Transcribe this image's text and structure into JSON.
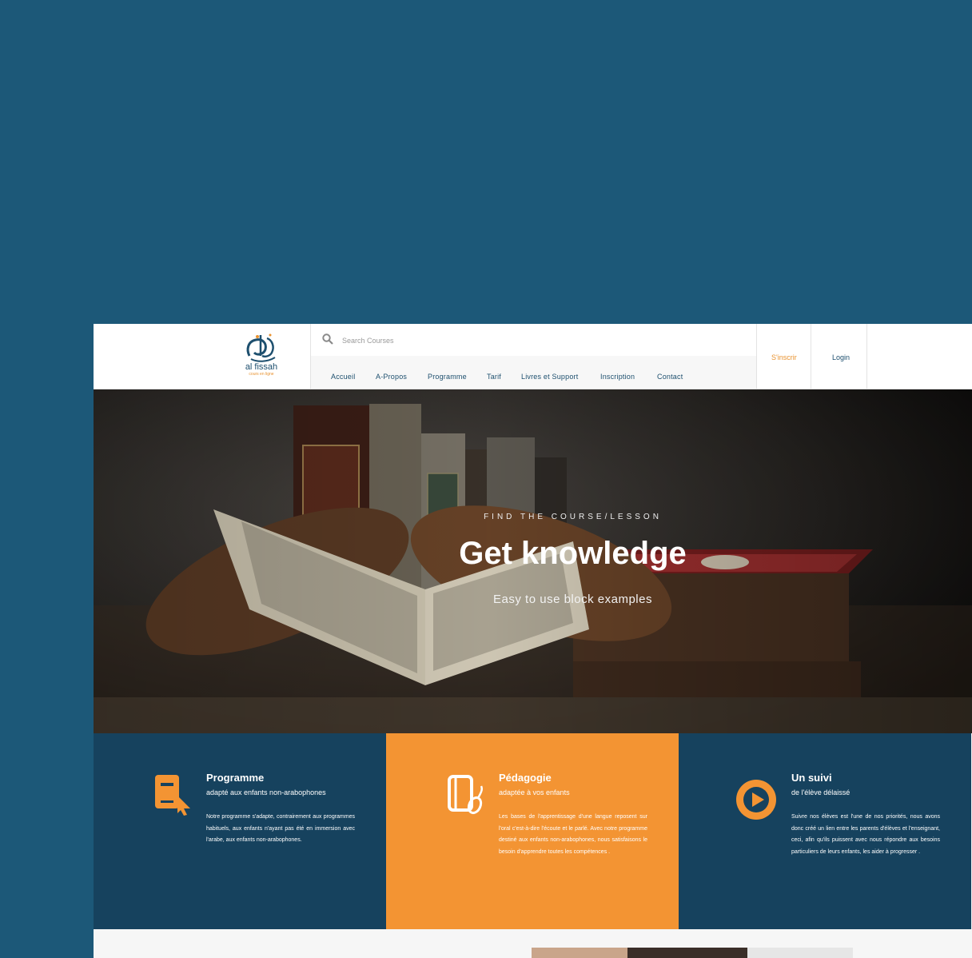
{
  "header": {
    "logo": {
      "name": "al fissah",
      "tagline": "cours en ligne"
    },
    "search": {
      "placeholder": "Search Courses"
    },
    "nav": [
      "Accueil",
      "A-Propos",
      "Programme",
      "Tarif",
      "Livres et Support",
      "Inscription",
      "Contact"
    ],
    "signup_label": "S'inscrir",
    "login_label": "Login"
  },
  "hero": {
    "kicker": "FIND THE COURSE/LESSON",
    "title": "Get knowledge",
    "subtitle": "Easy to use block examples"
  },
  "features": [
    {
      "icon": "book-cursor-icon",
      "title": "Programme",
      "subtitle": "adapté aux enfants non-arabophones",
      "text": "Notre programme s'adapte, contrairement aux programmes habituels, aux enfants n'ayant pas été en immersion avec l'arabe, aux enfants non-arabophones."
    },
    {
      "icon": "book-mouse-icon",
      "title": "Pédagogie",
      "subtitle": "adaptée à vos enfants",
      "text": "Les bases de l'apprentissage d'une langue reposent sur l'oral c'est-à-dire l'écoute et le parlé. Avec notre programme destiné aux enfants non-arabophones, nous satisfaisons le besoin d'apprendre toutes les compétences ."
    },
    {
      "icon": "play-circle-icon",
      "title": "Un suivi",
      "subtitle": "de l'élève délaissé",
      "text": "Suivre nos élèves est l'une de nos priorités, nous avons donc créé un lien entre les parents d'élèves et l'enseignant, ceci, afin qu'ils puissent avec nous répondre aux besoins particuliers de leurs enfants, les aider à progresser ."
    }
  ],
  "colors": {
    "background": "#1c5878",
    "navy": "#16425e",
    "orange": "#f39433",
    "nav_text": "#1d4f6e"
  }
}
